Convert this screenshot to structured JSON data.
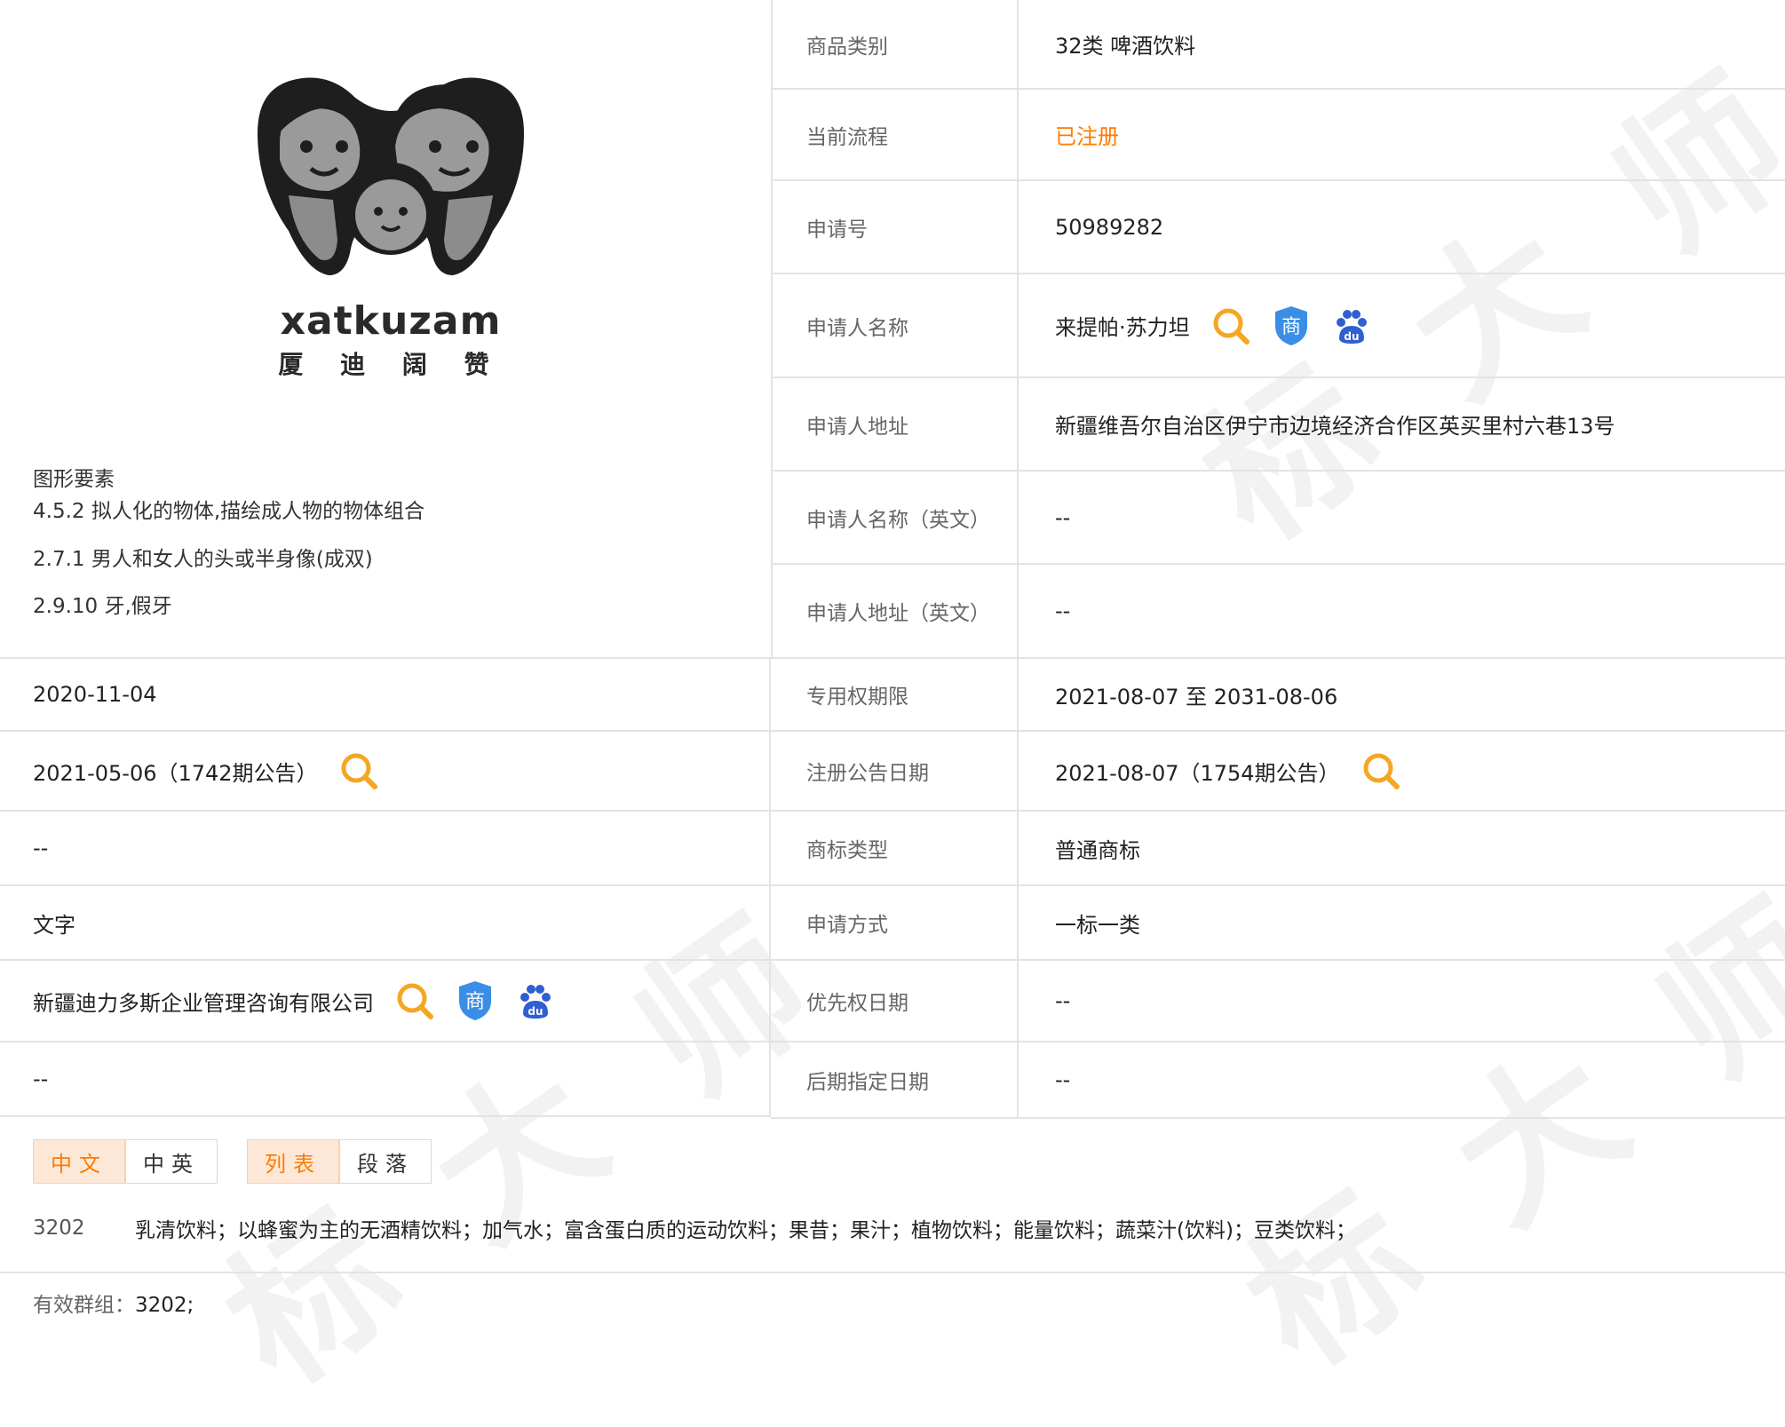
{
  "logo": {
    "latin": "xatkuzam",
    "cjk": "厦 迪 阔 赞"
  },
  "figure": {
    "title": "图形要素",
    "items": [
      "4.5.2 拟人化的物体,描绘成人物的物体组合",
      "2.7.1 男人和女人的头或半身像(成双)",
      "2.9.10 牙,假牙"
    ]
  },
  "right_rows": [
    {
      "label": "商品类别",
      "value": "32类 啤酒饮料"
    },
    {
      "label": "当前流程",
      "value": "已注册"
    },
    {
      "label": "申请号",
      "value": "50989282"
    },
    {
      "label": "申请人名称",
      "value": "来提帕·苏力坦"
    },
    {
      "label": "申请人地址",
      "value": "新疆维吾尔自治区伊宁市边境经济合作区英买里村六巷13号"
    },
    {
      "label": "申请人名称（英文）",
      "value": "--"
    },
    {
      "label": "申请人地址（英文）",
      "value": "--"
    },
    {
      "label": "专用权期限",
      "value": "2021-08-07 至 2031-08-06"
    },
    {
      "label": "注册公告日期",
      "value": "2021-08-07（1754期公告）"
    },
    {
      "label": "商标类型",
      "value": "普通商标"
    },
    {
      "label": "申请方式",
      "value": "一标一类"
    },
    {
      "label": "优先权日期",
      "value": "--"
    },
    {
      "label": "后期指定日期",
      "value": "--"
    }
  ],
  "left_rows": [
    {
      "value": "2020-11-04"
    },
    {
      "value": "2021-05-06（1742期公告）"
    },
    {
      "value": "--"
    },
    {
      "value": "文字"
    },
    {
      "value": "新疆迪力多斯企业管理咨询有限公司"
    },
    {
      "value": "--"
    }
  ],
  "tabs": {
    "lang": [
      "中文",
      "中英"
    ],
    "view": [
      "列表",
      "段落"
    ]
  },
  "goods": {
    "code": "3202",
    "text": "乳清饮料；以蜂蜜为主的无酒精饮料；加气水；富含蛋白质的运动饮料；果昔；果汁；植物饮料；能量饮料；蔬菜汁(饮料)；豆类饮料；"
  },
  "group": {
    "label": "有效群组：",
    "value": "3202;"
  },
  "icons": {
    "search": "search-icon",
    "shang": "shang-shield-icon",
    "baidu": "baidu-paw-icon",
    "shield_char": "商",
    "paw_text": "du"
  },
  "colors": {
    "accent": "#ff7a00",
    "shield": "#3a8ee6",
    "baidu": "#2f5fd0",
    "border": "#e3e3e3"
  }
}
